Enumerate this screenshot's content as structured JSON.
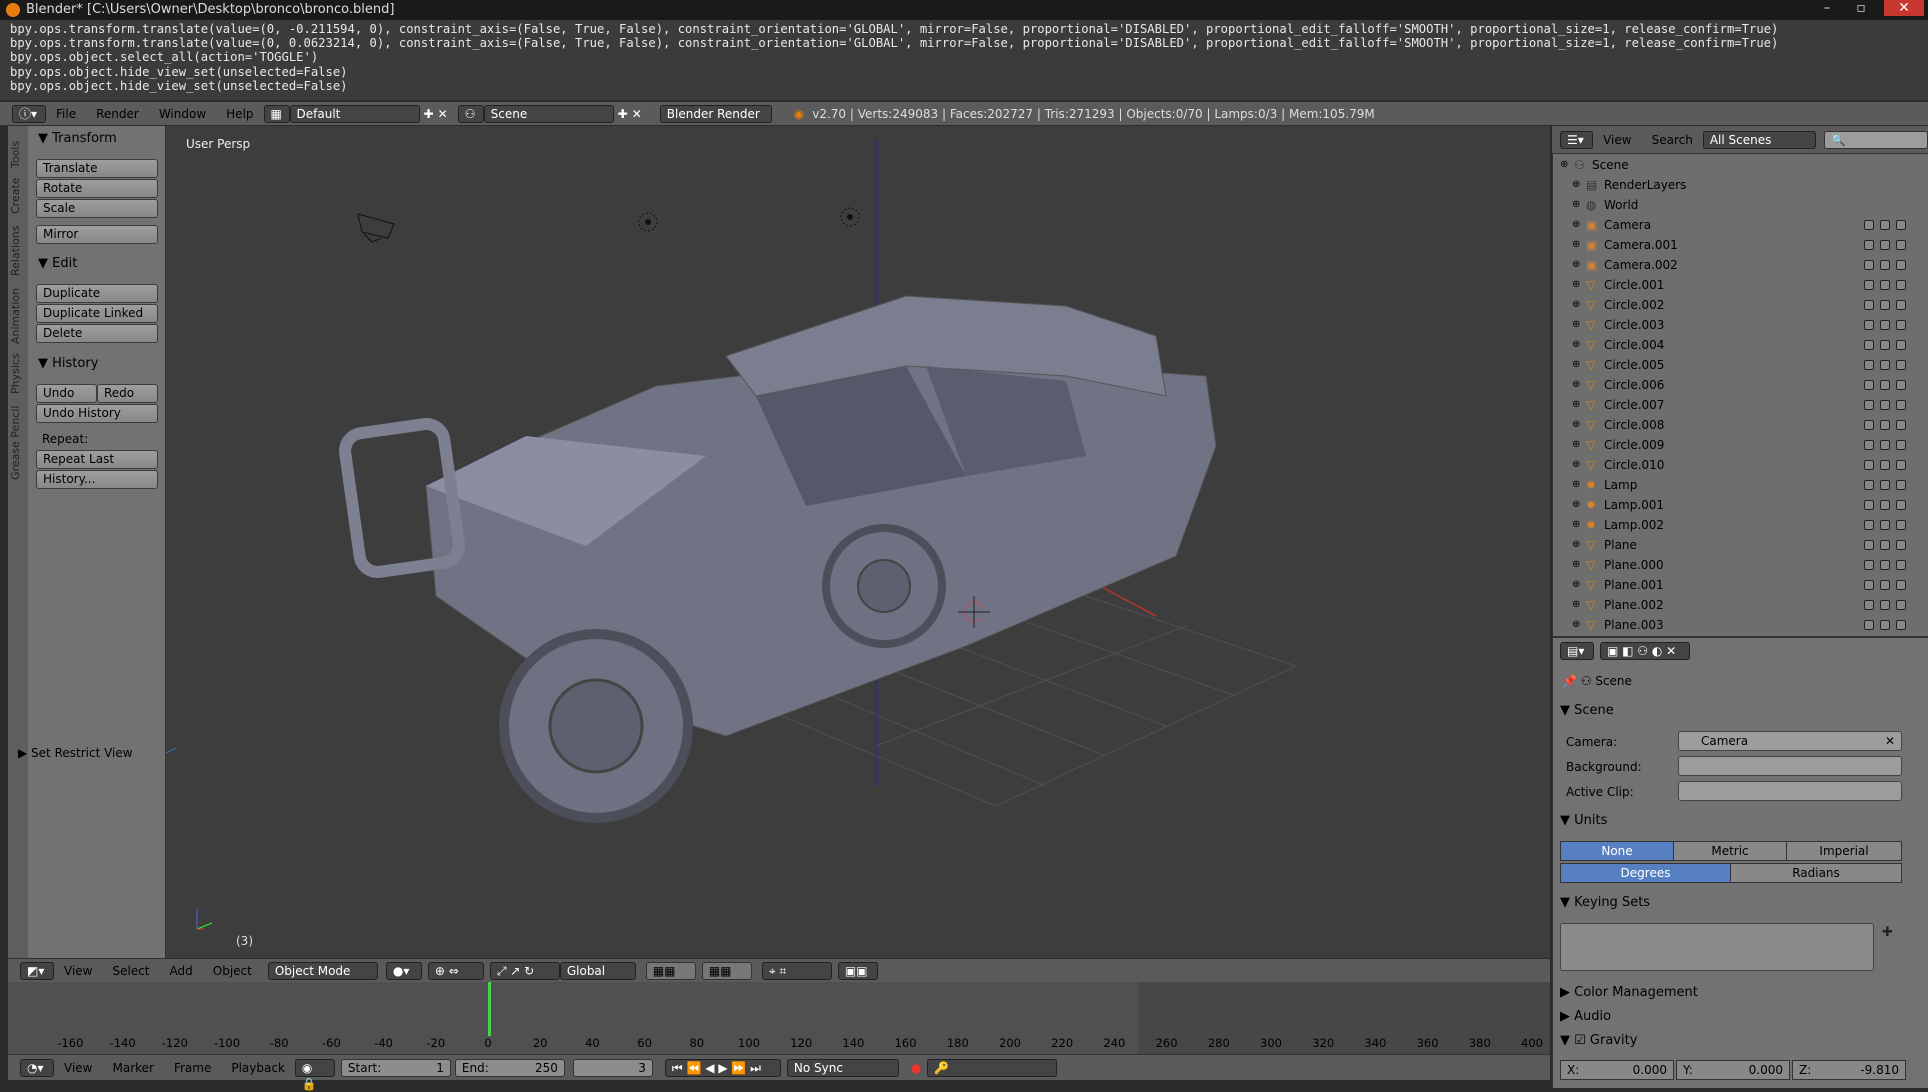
{
  "window": {
    "title": "Blender* [C:\\Users\\Owner\\Desktop\\bronco\\bronco.blend]"
  },
  "info_log": [
    "bpy.ops.transform.translate(value=(0, -0.211594, 0), constraint_axis=(False, True, False), constraint_orientation='GLOBAL', mirror=False, proportional='DISABLED', proportional_edit_falloff='SMOOTH', proportional_size=1, release_confirm=True)",
    "bpy.ops.transform.translate(value=(0, 0.0623214, 0), constraint_axis=(False, True, False), constraint_orientation='GLOBAL', mirror=False, proportional='DISABLED', proportional_edit_falloff='SMOOTH', proportional_size=1, release_confirm=True)",
    "bpy.ops.object.select_all(action='TOGGLE')",
    "bpy.ops.object.hide_view_set(unselected=False)",
    "bpy.ops.object.hide_view_set(unselected=False)"
  ],
  "menubar": {
    "file": "File",
    "render": "Render",
    "window": "Window",
    "help": "Help",
    "layout": "Default",
    "scene": "Scene",
    "engine": "Blender Render",
    "stats": "v2.70 | Verts:249083 | Faces:202727 | Tris:271293 | Objects:0/70 | Lamps:0/3 | Mem:105.79M"
  },
  "toolshelf": {
    "tabs": [
      "Tools",
      "Create",
      "Relations",
      "Animation",
      "Physics",
      "Grease Pencil"
    ],
    "transform_header": "Transform",
    "translate": "Translate",
    "rotate": "Rotate",
    "scale": "Scale",
    "mirror": "Mirror",
    "edit_header": "Edit",
    "duplicate": "Duplicate",
    "duplicate_linked": "Duplicate Linked",
    "delete": "Delete",
    "history_header": "History",
    "undo": "Undo",
    "redo": "Redo",
    "undo_history": "Undo History",
    "repeat_label": "Repeat:",
    "repeat_last": "Repeat Last",
    "history_btn": "History...",
    "set_restrict": "Set Restrict View"
  },
  "viewport": {
    "label": "User Persp",
    "frame_indicator": "(3)"
  },
  "viewport_footer": {
    "view": "View",
    "select": "Select",
    "add": "Add",
    "object": "Object",
    "mode": "Object Mode",
    "orientation": "Global"
  },
  "timeline": {
    "ticks": [
      "-160",
      "-140",
      "-120",
      "-100",
      "-80",
      "-60",
      "-40",
      "-20",
      "0",
      "20",
      "40",
      "60",
      "80",
      "100",
      "120",
      "140",
      "160",
      "180",
      "200",
      "220",
      "240",
      "260",
      "280",
      "300",
      "320",
      "340",
      "360",
      "380",
      "400"
    ],
    "current_frame": 3
  },
  "timeline_footer": {
    "view": "View",
    "marker": "Marker",
    "frame": "Frame",
    "playback": "Playback",
    "start": "Start:",
    "start_val": "1",
    "end": "End:",
    "end_val": "250",
    "current": "3",
    "sync": "No Sync"
  },
  "outliner": {
    "view": "View",
    "search": "Search",
    "filter": "All Scenes",
    "items": [
      {
        "name": "Scene",
        "indent": 0,
        "type": "scene"
      },
      {
        "name": "RenderLayers",
        "indent": 1,
        "type": "layers"
      },
      {
        "name": "World",
        "indent": 1,
        "type": "world"
      },
      {
        "name": "Camera",
        "indent": 1,
        "type": "camera"
      },
      {
        "name": "Camera.001",
        "indent": 1,
        "type": "camera"
      },
      {
        "name": "Camera.002",
        "indent": 1,
        "type": "camera"
      },
      {
        "name": "Circle.001",
        "indent": 1,
        "type": "mesh"
      },
      {
        "name": "Circle.002",
        "indent": 1,
        "type": "mesh"
      },
      {
        "name": "Circle.003",
        "indent": 1,
        "type": "mesh"
      },
      {
        "name": "Circle.004",
        "indent": 1,
        "type": "mesh"
      },
      {
        "name": "Circle.005",
        "indent": 1,
        "type": "mesh"
      },
      {
        "name": "Circle.006",
        "indent": 1,
        "type": "mesh"
      },
      {
        "name": "Circle.007",
        "indent": 1,
        "type": "mesh"
      },
      {
        "name": "Circle.008",
        "indent": 1,
        "type": "mesh"
      },
      {
        "name": "Circle.009",
        "indent": 1,
        "type": "mesh"
      },
      {
        "name": "Circle.010",
        "indent": 1,
        "type": "mesh"
      },
      {
        "name": "Lamp",
        "indent": 1,
        "type": "lamp"
      },
      {
        "name": "Lamp.001",
        "indent": 1,
        "type": "lamp"
      },
      {
        "name": "Lamp.002",
        "indent": 1,
        "type": "lamp"
      },
      {
        "name": "Plane",
        "indent": 1,
        "type": "mesh"
      },
      {
        "name": "Plane.000",
        "indent": 1,
        "type": "mesh"
      },
      {
        "name": "Plane.001",
        "indent": 1,
        "type": "mesh"
      },
      {
        "name": "Plane.002",
        "indent": 1,
        "type": "mesh"
      },
      {
        "name": "Plane.003",
        "indent": 1,
        "type": "mesh"
      }
    ]
  },
  "properties": {
    "context": "Scene",
    "scene_header": "Scene",
    "camera_label": "Camera:",
    "camera_val": "Camera",
    "background_label": "Background:",
    "clip_label": "Active Clip:",
    "units_header": "Units",
    "none": "None",
    "metric": "Metric",
    "imperial": "Imperial",
    "degrees": "Degrees",
    "radians": "Radians",
    "keying_header": "Keying Sets",
    "color_mgmt": "Color Management",
    "audio": "Audio",
    "gravity": "Gravity",
    "gx": "X:",
    "gx_val": "0.000",
    "gy": "Y:",
    "gy_val": "0.000",
    "gz": "Z:",
    "gz_val": "-9.810"
  }
}
